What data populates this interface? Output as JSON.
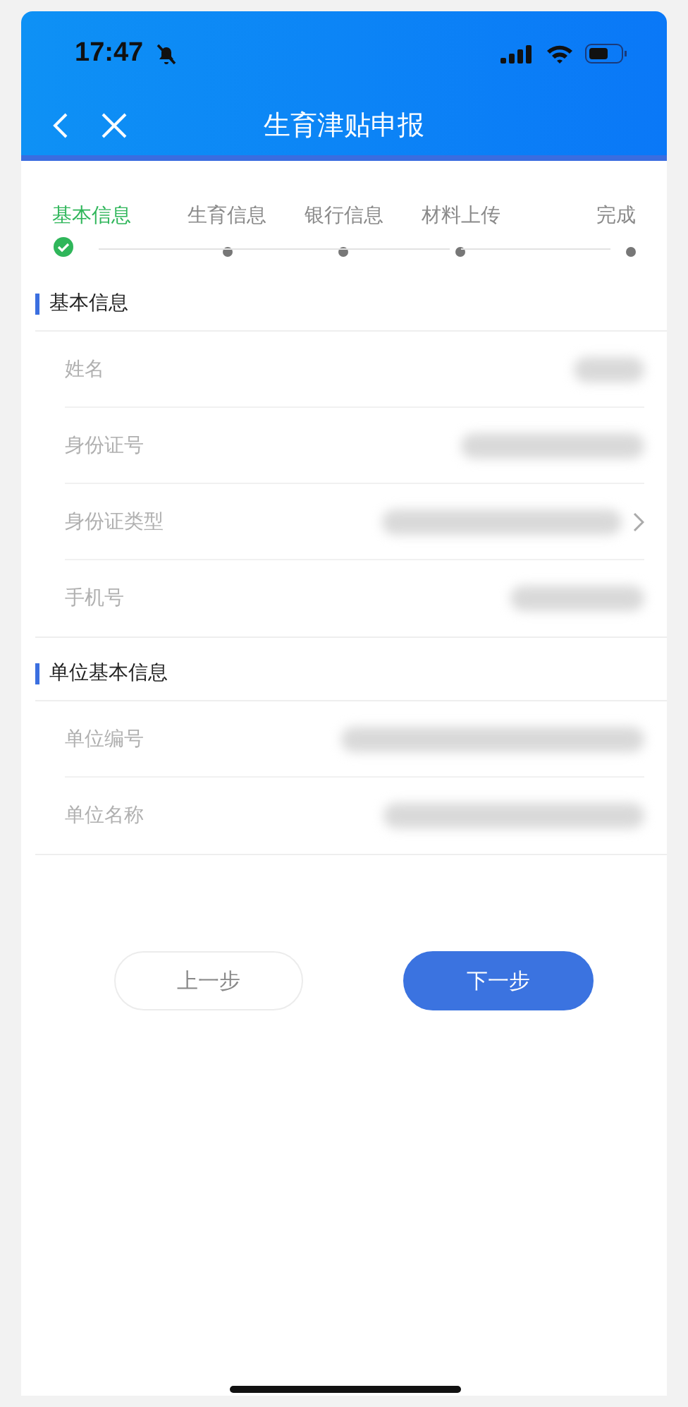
{
  "status_bar": {
    "time": "17:47"
  },
  "nav": {
    "title": "生育津贴申报"
  },
  "steps": [
    {
      "label": "基本信息",
      "selected": true
    },
    {
      "label": "生育信息",
      "selected": false
    },
    {
      "label": "银行信息",
      "selected": false
    },
    {
      "label": "材料上传",
      "selected": false
    },
    {
      "label": "完成",
      "selected": false
    }
  ],
  "sections": [
    {
      "title": "基本信息",
      "fields": [
        {
          "label": "姓名",
          "kind": "text"
        },
        {
          "label": "身份证号",
          "kind": "text"
        },
        {
          "label": "身份证类型",
          "kind": "select"
        },
        {
          "label": "手机号",
          "kind": "text"
        }
      ]
    },
    {
      "title": "单位基本信息",
      "fields": [
        {
          "label": "单位编号",
          "kind": "text"
        },
        {
          "label": "单位名称",
          "kind": "text"
        }
      ]
    }
  ],
  "buttons": {
    "prev": "上一步",
    "next": "下一步"
  }
}
